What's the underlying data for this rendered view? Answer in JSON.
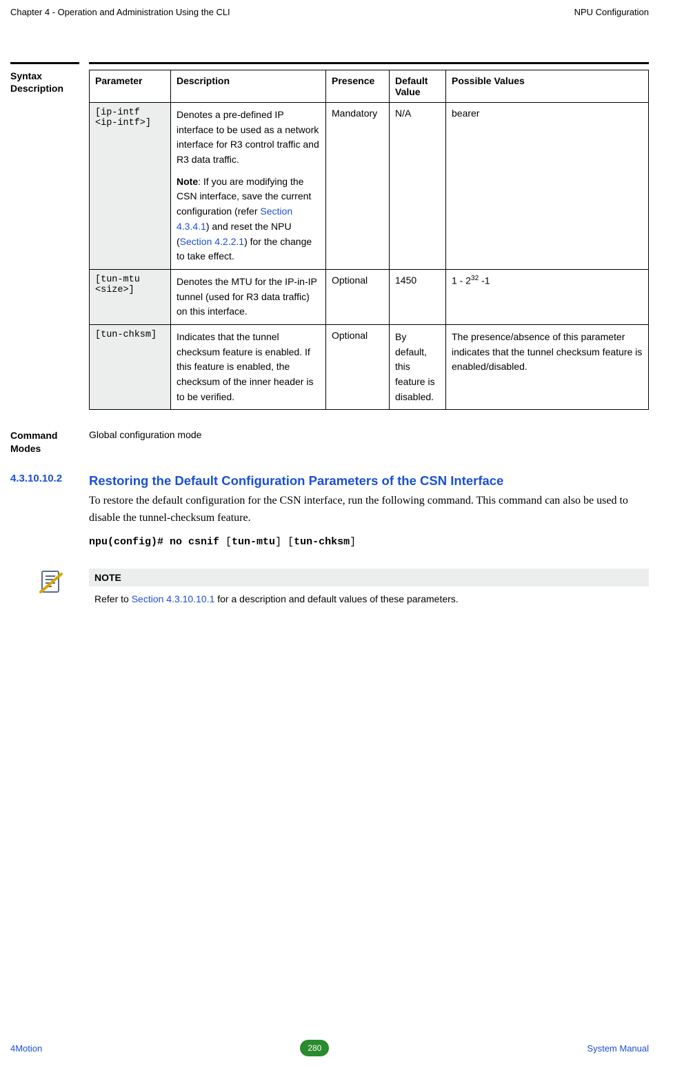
{
  "header": {
    "left": "Chapter 4 - Operation and Administration Using the CLI",
    "right": "NPU Configuration"
  },
  "syntax_label": "Syntax Description",
  "table": {
    "headers": {
      "param": "Parameter",
      "desc": "Description",
      "presence": "Presence",
      "def": "Default Value",
      "poss": "Possible Values"
    },
    "rows": [
      {
        "param": "[ip-intf <ip-intf>]",
        "desc1": "Denotes a pre-defined IP interface to be used as a network interface for R3 control traffic and R3 data traffic.",
        "note_prefix": "Note",
        "note_a": ": If you are modifying the CSN interface, save the current configuration (refer ",
        "link1": "Section 4.3.4.1",
        "note_b": ") and reset the NPU (",
        "link2": "Section 4.2.2.1",
        "note_c": ") for the change to take effect.",
        "presence": "Mandatory",
        "def": "N/A",
        "poss": "bearer"
      },
      {
        "param": "[tun-mtu <size>]",
        "desc": "Denotes the MTU for the IP-in-IP tunnel (used for R3 data traffic) on this interface.",
        "presence": "Optional",
        "def": "1450",
        "poss_a": "1 - 2",
        "poss_sup": "32",
        "poss_b": " -1"
      },
      {
        "param": "[tun-chksm]",
        "desc": "Indicates that the tunnel checksum feature is enabled. If this feature is enabled, the checksum of the inner header is to be verified.",
        "presence": "Optional",
        "def": "By default, this feature is disabled.",
        "poss": "The presence/absence of this parameter indicates that the tunnel checksum feature is enabled/disabled."
      }
    ]
  },
  "modes": {
    "label": "Command Modes",
    "value": "Global configuration mode"
  },
  "section": {
    "num": "4.3.10.10.2",
    "title": "Restoring the Default Configuration Parameters of the CSN Interface",
    "body": "To restore the default configuration for the CSN interface, run the following command. This command can also be used to disable the tunnel-checksum feature.",
    "cmd_a": "npu(config)# no csnif",
    "cmd_b": " [",
    "cmd_c": "tun-mtu",
    "cmd_d": "] [",
    "cmd_e": "tun-chksm",
    "cmd_f": "]"
  },
  "note": {
    "head": "NOTE",
    "a": "Refer to ",
    "link": "Section 4.3.10.10.1",
    "b": " for a description and default values of these parameters."
  },
  "footer": {
    "brand": "4Motion",
    "page": "280",
    "sys": "System Manual"
  }
}
